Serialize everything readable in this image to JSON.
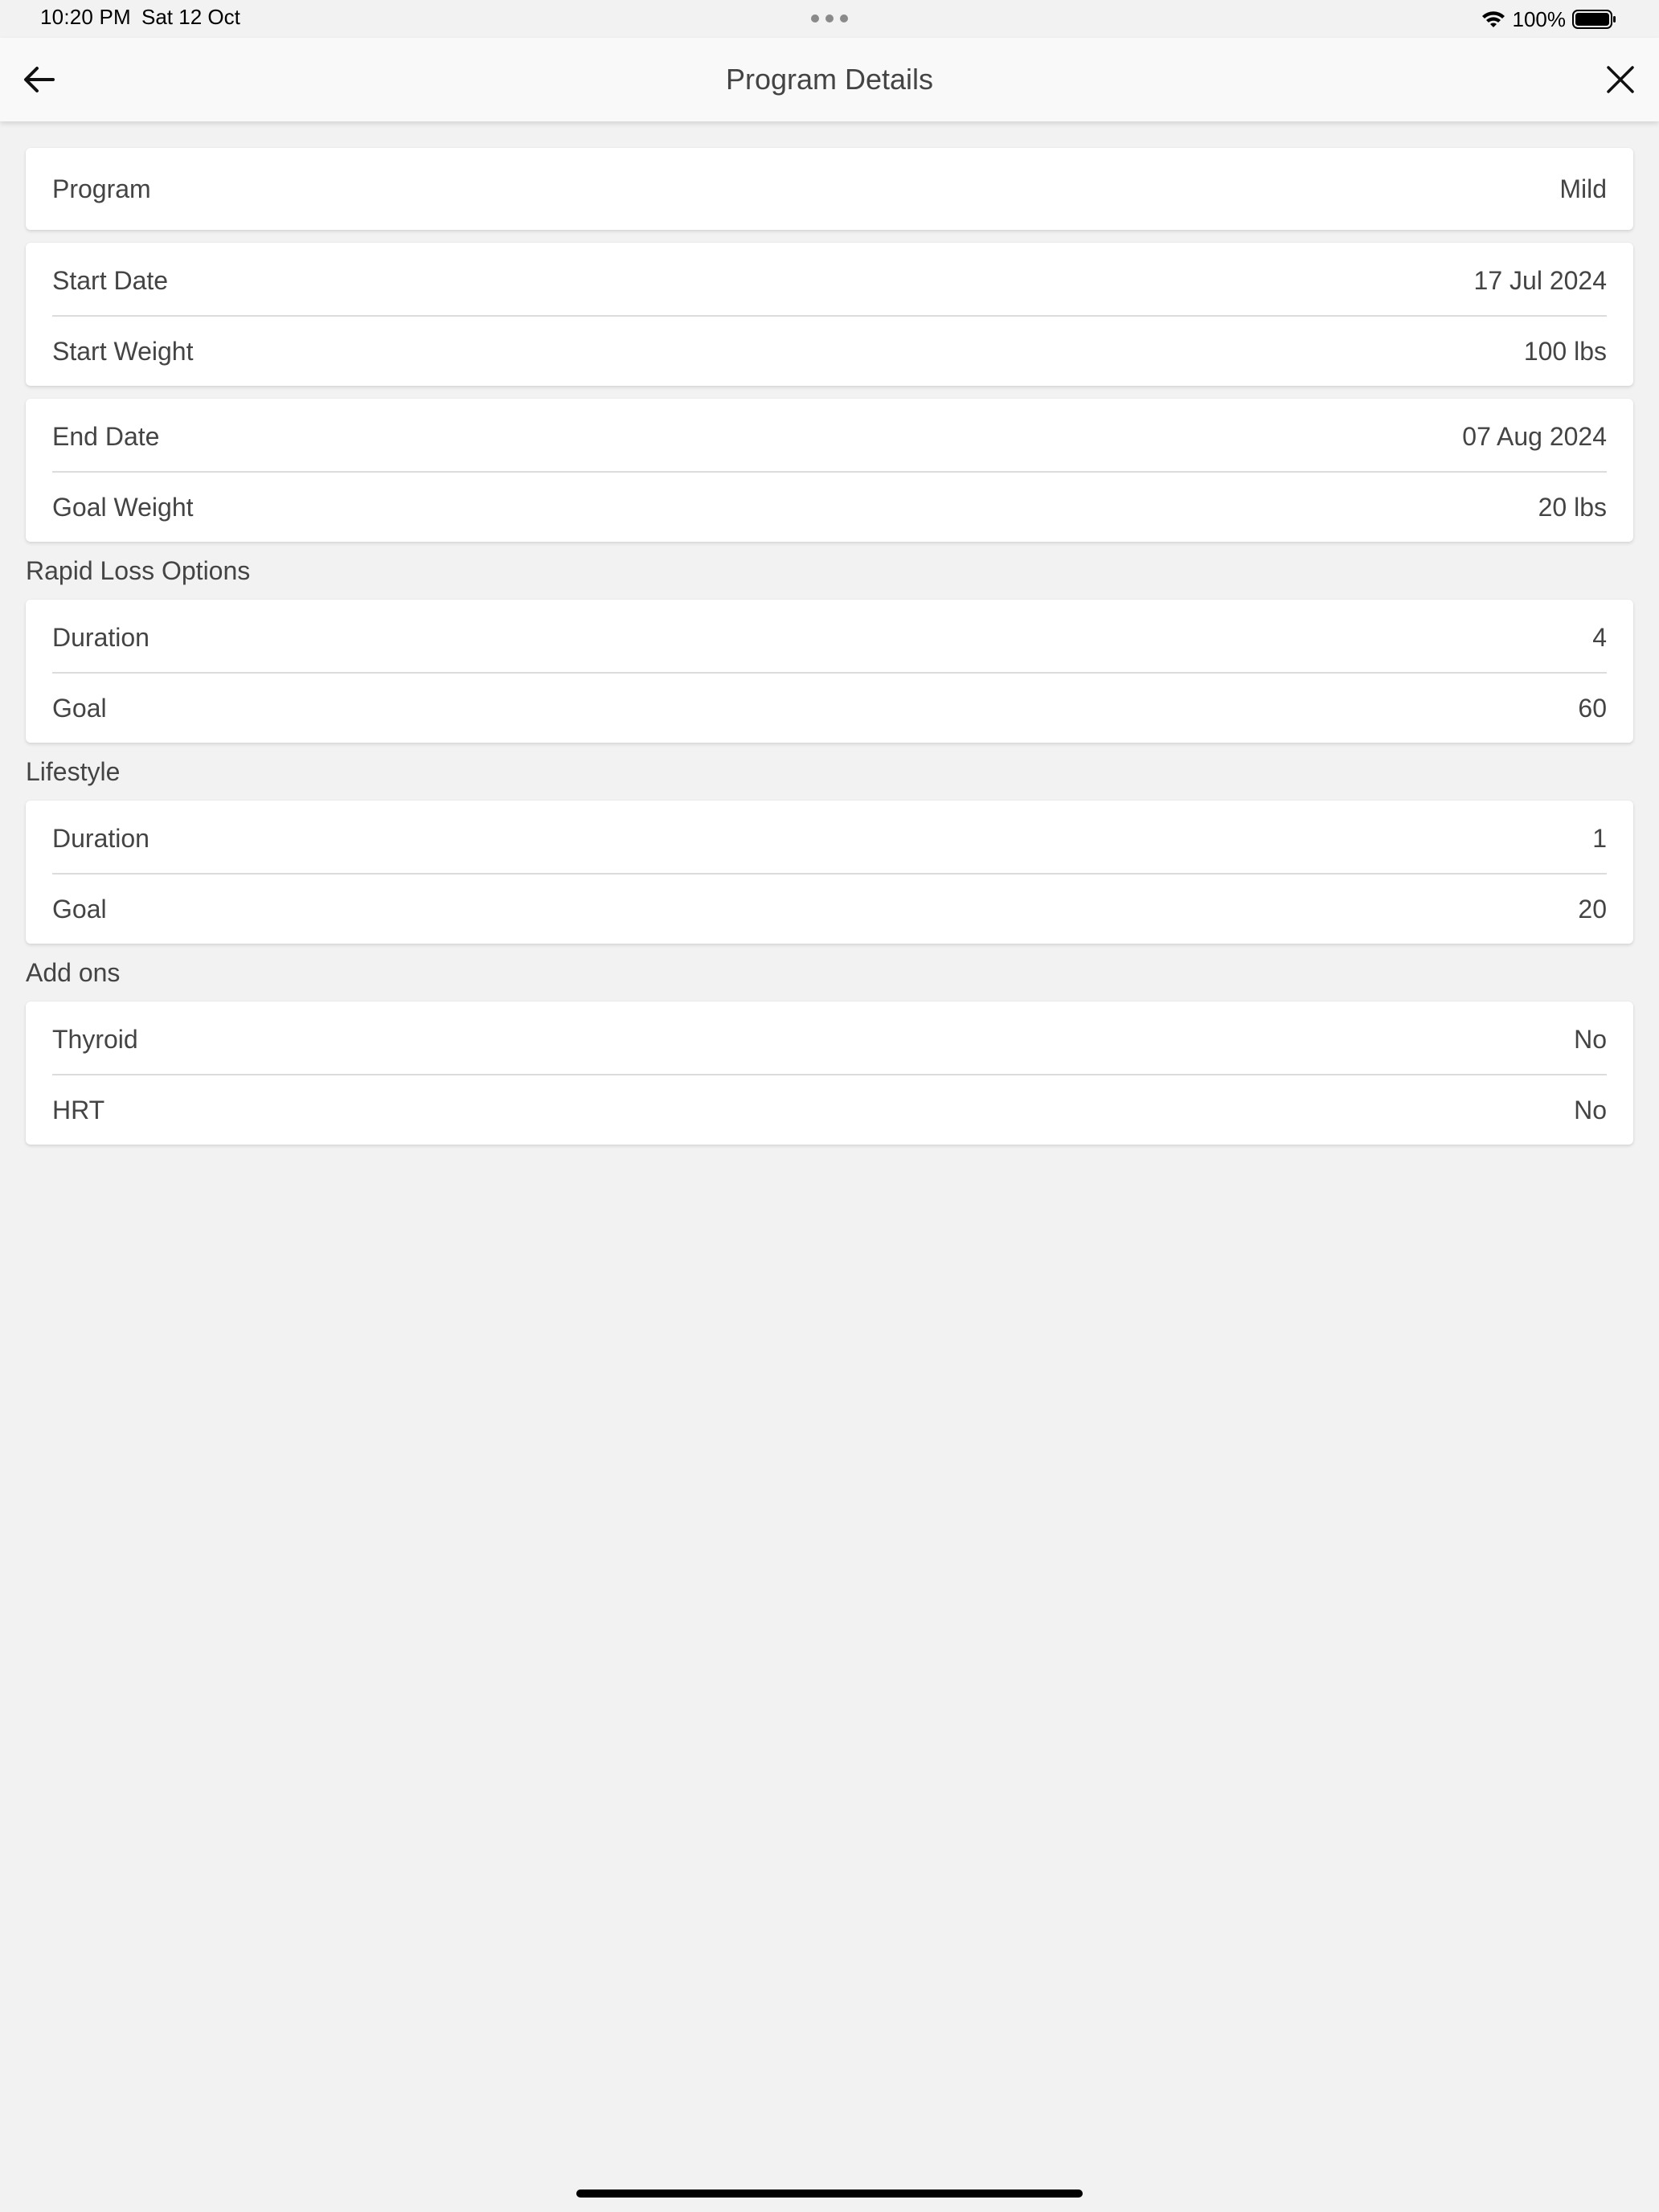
{
  "status_bar": {
    "time": "10:20 PM",
    "date": "Sat 12 Oct",
    "battery": "100%"
  },
  "header": {
    "title": "Program Details"
  },
  "cards": [
    {
      "rows": [
        {
          "label": "Program",
          "value": "Mild"
        }
      ]
    },
    {
      "rows": [
        {
          "label": "Start Date",
          "value": "17 Jul 2024"
        },
        {
          "label": "Start Weight",
          "value": "100 lbs"
        }
      ]
    },
    {
      "rows": [
        {
          "label": "End Date",
          "value": "07 Aug 2024"
        },
        {
          "label": "Goal Weight",
          "value": "20 lbs"
        }
      ]
    }
  ],
  "sections": [
    {
      "title": "Rapid Loss Options",
      "rows": [
        {
          "label": "Duration",
          "value": "4"
        },
        {
          "label": "Goal",
          "value": "60"
        }
      ]
    },
    {
      "title": "Lifestyle",
      "rows": [
        {
          "label": "Duration",
          "value": "1"
        },
        {
          "label": "Goal",
          "value": "20"
        }
      ]
    },
    {
      "title": "Add ons",
      "rows": [
        {
          "label": "Thyroid",
          "value": "No"
        },
        {
          "label": "HRT",
          "value": "No"
        }
      ]
    }
  ]
}
